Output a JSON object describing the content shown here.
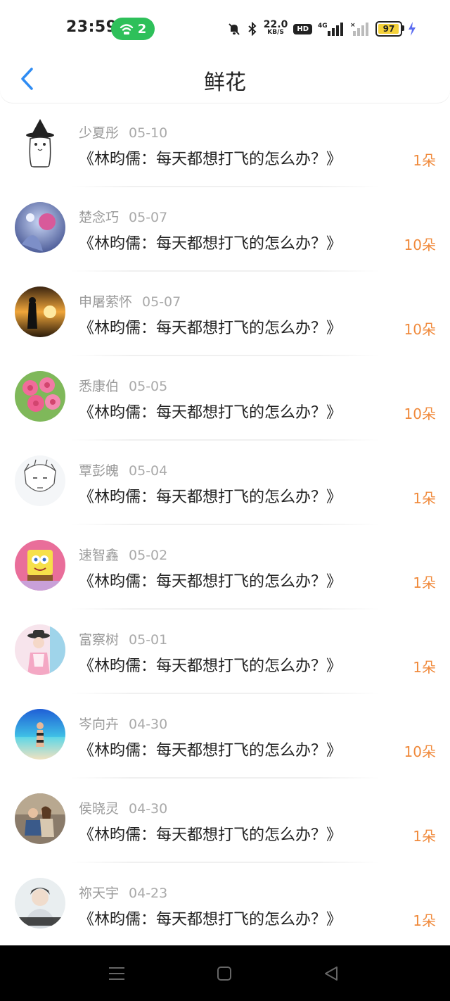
{
  "status_bar": {
    "time": "23:59",
    "hotspot_count": "2",
    "net_speed_value": "22.0",
    "net_speed_unit": "KB/S",
    "hd_label": "HD",
    "network_label": "4G",
    "battery_level": "97"
  },
  "header": {
    "title": "鲜花"
  },
  "rows": [
    {
      "name": "少夏彤",
      "date": "05-10",
      "title": "《林昀儒：每天都想打飞的怎么办？》",
      "count": "1朵",
      "avatar": "cat-hat"
    },
    {
      "name": "楚念巧",
      "date": "05-07",
      "title": "《林昀儒：每天都想打飞的怎么办？》",
      "count": "10朵",
      "avatar": "fantasy"
    },
    {
      "name": "申屠萦怀",
      "date": "05-07",
      "title": "《林昀儒：每天都想打飞的怎么办？》",
      "count": "10朵",
      "avatar": "sunset"
    },
    {
      "name": "悉康伯",
      "date": "05-05",
      "title": "《林昀儒：每天都想打飞的怎么办？》",
      "count": "10朵",
      "avatar": "roses"
    },
    {
      "name": "覃彭魄",
      "date": "05-04",
      "title": "《林昀儒：每天都想打飞的怎么办？》",
      "count": "1朵",
      "avatar": "sketch"
    },
    {
      "name": "速智鑫",
      "date": "05-02",
      "title": "《林昀儒：每天都想打飞的怎么办？》",
      "count": "1朵",
      "avatar": "sponge"
    },
    {
      "name": "富察树",
      "date": "05-01",
      "title": "《林昀儒：每天都想打飞的怎么办？》",
      "count": "1朵",
      "avatar": "hat-girl"
    },
    {
      "name": "岑向卉",
      "date": "04-30",
      "title": "《林昀儒：每天都想打飞的怎么办？》",
      "count": "10朵",
      "avatar": "beach"
    },
    {
      "name": "侯晓灵",
      "date": "04-30",
      "title": "《林昀儒：每天都想打飞的怎么办？》",
      "count": "1朵",
      "avatar": "couple"
    },
    {
      "name": "祢天宇",
      "date": "04-23",
      "title": "《林昀儒：每天都想打飞的怎么办？》",
      "count": "1朵",
      "avatar": "portrait"
    }
  ],
  "colors": {
    "accent_back": "#2f8cf3",
    "count_orange": "#f08a3c",
    "hotspot_green": "#2ec05a"
  }
}
